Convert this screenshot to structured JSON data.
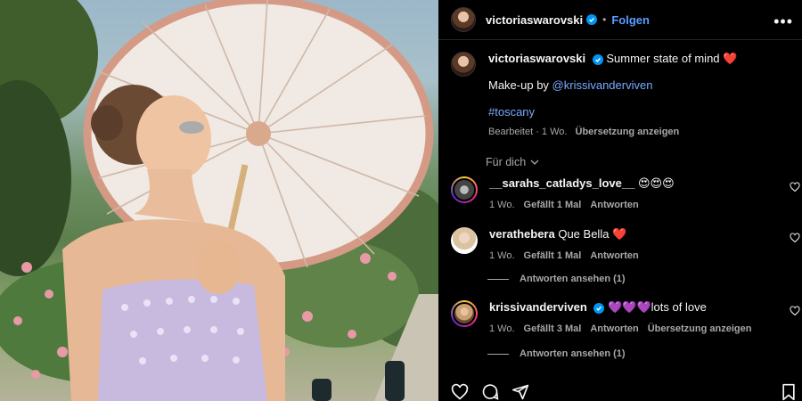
{
  "post": {
    "author": "victoriaswarovski",
    "separator": "•",
    "follow_label": "Folgen",
    "more_label": "•••"
  },
  "caption": {
    "author": "victoriaswarovski",
    "line1": "Summer state of mind",
    "heart": "❤️",
    "makeup_prefix": "Make-up by ",
    "makeup_link": "@krissivanderviven",
    "hashtag": "#toscany",
    "edited": "Bearbeitet · 1 Wo.",
    "translate": "Übersetzung anzeigen"
  },
  "sort_label": "Für dich",
  "comments": [
    {
      "user": "__sarahs_catladys_love__",
      "text": "😍😍😍",
      "time": "1 Wo.",
      "likes": "Gefällt 1 Mal",
      "reply": "Antworten",
      "translate": ""
    },
    {
      "user": "verathebera",
      "text": "Que Bella ❤️",
      "time": "1 Wo.",
      "likes": "Gefällt 1 Mal",
      "reply": "Antworten",
      "translate": "",
      "replies_label": "Antworten ansehen (1)"
    },
    {
      "user": "krissivanderviven",
      "text": "💜💜💜lots of love",
      "time": "1 Wo.",
      "likes": "Gefällt 3 Mal",
      "reply": "Antworten",
      "translate": "Übersetzung anzeigen",
      "replies_label": "Antworten ansehen (1)"
    }
  ],
  "icons": {
    "like": "heart-icon",
    "comment": "comment-icon",
    "share": "share-icon",
    "save": "bookmark-icon",
    "verified": "verified-badge-icon"
  },
  "colors": {
    "link": "#7aa9ff",
    "follow": "#5b9cff",
    "verified": "#0095f6"
  }
}
